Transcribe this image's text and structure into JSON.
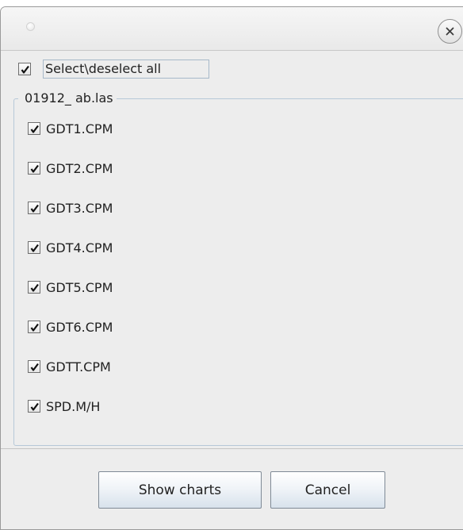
{
  "dialog": {
    "select_all_label": "Select\\deselect all",
    "select_all_checked": true,
    "group_title": "01912_  ab.las",
    "items": [
      {
        "label": "GDT1.CPM",
        "checked": true
      },
      {
        "label": "GDT2.CPM",
        "checked": true
      },
      {
        "label": "GDT3.CPM",
        "checked": true
      },
      {
        "label": "GDT4.CPM",
        "checked": true
      },
      {
        "label": "GDT5.CPM",
        "checked": true
      },
      {
        "label": "GDT6.CPM",
        "checked": true
      },
      {
        "label": "GDTT.CPM",
        "checked": true
      },
      {
        "label": "SPD.M/H",
        "checked": true
      }
    ],
    "show_charts_label": "Show charts",
    "cancel_label": "Cancel"
  },
  "icons": {
    "close": "close-icon",
    "checkmark": "checkmark-icon",
    "window": "window-dot-icon"
  },
  "colors": {
    "window_bg": "#ededed",
    "group_border": "#b6c8d8",
    "focus_border": "#a7b9c9",
    "button_border": "#7f8a96"
  }
}
